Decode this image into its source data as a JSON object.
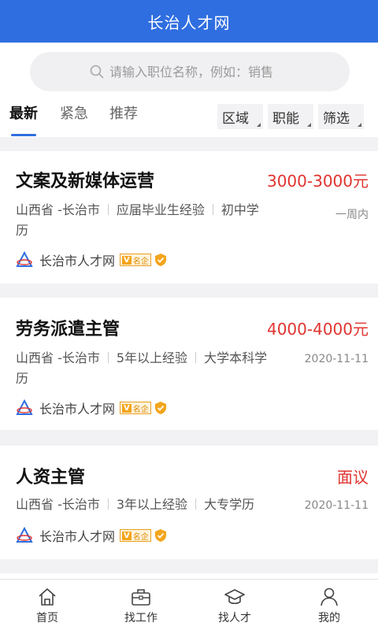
{
  "header": {
    "title": "长治人才网"
  },
  "search": {
    "placeholder": "请输入职位名称，例如：销售"
  },
  "tabs": [
    {
      "label": "最新",
      "active": true
    },
    {
      "label": "紧急",
      "active": false
    },
    {
      "label": "推荐",
      "active": false
    }
  ],
  "filters": [
    {
      "label": "区域"
    },
    {
      "label": "职能"
    },
    {
      "label": "筛选"
    }
  ],
  "jobs": [
    {
      "title": "文案及新媒体运营",
      "salary": "3000-3000元",
      "location": "山西省 -长治市",
      "experience": "应届毕业生经验",
      "education_line1": "初中学",
      "education_line2": "历",
      "date": "一周内",
      "company": "长治市人才网",
      "badge_v": "V",
      "badge_text": "名企"
    },
    {
      "title": "劳务派遣主管",
      "salary": "4000-4000元",
      "location": "山西省 -长治市",
      "experience": "5年以上经验",
      "education_line1": "大学本科学",
      "education_line2": "历",
      "date": "2020-11-11",
      "company": "长治市人才网",
      "badge_v": "V",
      "badge_text": "名企"
    },
    {
      "title": "人资主管",
      "salary": "面议",
      "location": "山西省 -长治市",
      "experience": "3年以上经验",
      "education_line1": "大专学历",
      "education_line2": "",
      "date": "2020-11-11",
      "company": "长治市人才网",
      "badge_v": "V",
      "badge_text": "名企"
    }
  ],
  "bottom_nav": [
    {
      "label": "首页",
      "icon": "home-icon"
    },
    {
      "label": "找工作",
      "icon": "briefcase-icon"
    },
    {
      "label": "找人才",
      "icon": "graduation-cap-icon"
    },
    {
      "label": "我的",
      "icon": "user-icon"
    }
  ],
  "colors": {
    "brand": "#2f6ee0",
    "salary": "#e0342f"
  }
}
